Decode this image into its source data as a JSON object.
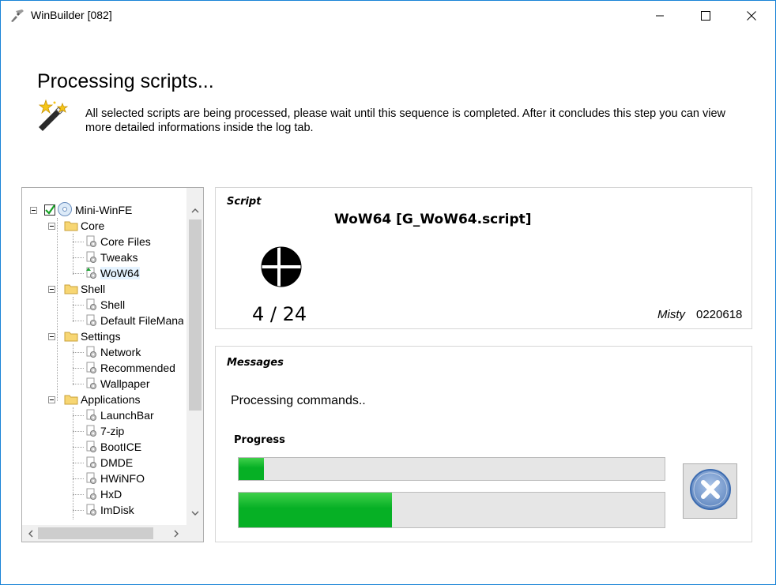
{
  "window": {
    "title": "WinBuilder [082]",
    "icons": {
      "app": "winbuilder-icon",
      "minimize": "minimize-icon",
      "maximize": "maximize-icon",
      "close": "close-icon"
    }
  },
  "header": {
    "heading": "Processing scripts...",
    "description": "All selected scripts are being processed, please wait until this sequence is completed. After it concludes this step you can view more detailed informations inside the log tab.",
    "icon": "magic-wand-icon"
  },
  "tree": {
    "root": "Mini-WinFE",
    "groups": [
      {
        "label": "Core",
        "items": [
          "Core Files",
          "Tweaks",
          "WoW64"
        ]
      },
      {
        "label": "Shell",
        "items": [
          "Shell",
          "Default FileManag"
        ]
      },
      {
        "label": "Settings",
        "items": [
          "Network",
          "Recommended",
          "Wallpaper"
        ]
      },
      {
        "label": "Applications",
        "items": [
          "LaunchBar",
          "7-zip",
          "BootICE",
          "DMDE",
          "HWiNFO",
          "HxD",
          "ImDisk"
        ]
      }
    ],
    "selected_item": "WoW64"
  },
  "script": {
    "group_label": "Script",
    "name": "WoW64 [G_WoW64.script]",
    "counter": "4 / 24",
    "author": "Misty",
    "version": "0220618"
  },
  "messages": {
    "group_label": "Messages",
    "text": "Processing commands..",
    "progress_label": "Progress",
    "command_progress": 0.06,
    "overall_progress": 0.36,
    "cancel_icon": "cancel-x-icon"
  },
  "colors": {
    "progress_fill": "#06b025",
    "window_border": "#1883d7",
    "cancel_icon": "#4d7fc0"
  }
}
